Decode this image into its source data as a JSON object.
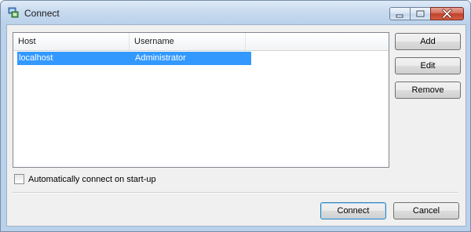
{
  "window": {
    "title": "Connect",
    "icon": "connect-app-icon",
    "caption_buttons": [
      "minimize-icon",
      "maximize-icon",
      "close-icon"
    ]
  },
  "list": {
    "columns": [
      "Host",
      "Username"
    ],
    "rows": [
      {
        "host": "localhost",
        "username": "Administrator",
        "selected": true
      }
    ],
    "selection_color": "#3399ff"
  },
  "side_buttons": {
    "add": "Add",
    "edit": "Edit",
    "remove": "Remove"
  },
  "options": {
    "auto_connect_label": "Automatically connect on start-up",
    "auto_connect_checked": false
  },
  "footer": {
    "connect": "Connect",
    "cancel": "Cancel"
  }
}
